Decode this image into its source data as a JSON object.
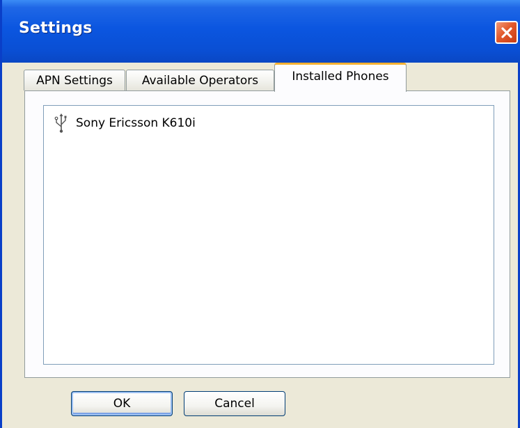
{
  "window": {
    "title": "Settings"
  },
  "tabs": [
    {
      "label": "APN Settings",
      "active": false
    },
    {
      "label": "Available Operators",
      "active": false
    },
    {
      "label": "Installed Phones",
      "active": true
    }
  ],
  "installed_phones": {
    "items": [
      {
        "name": "Sony Ericsson K610i",
        "icon": "usb-icon"
      }
    ]
  },
  "buttons": {
    "ok_label": "OK",
    "cancel_label": "Cancel"
  },
  "colors": {
    "titlebar": "#0a4fd4",
    "active_tab_accent": "#f5b132",
    "close_button": "#e25a2c"
  }
}
